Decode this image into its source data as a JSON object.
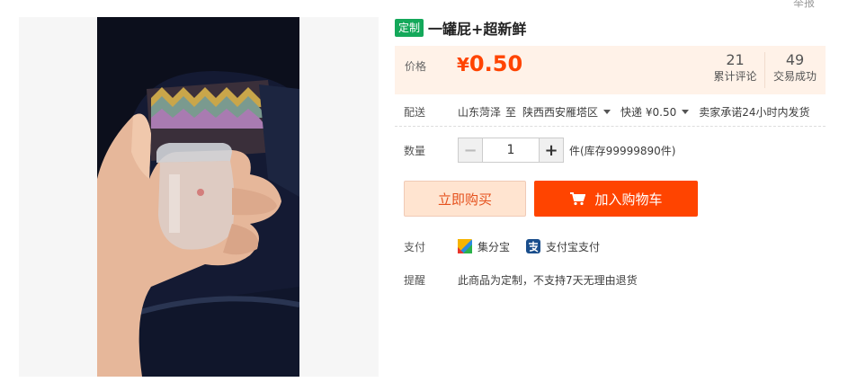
{
  "header": {
    "report_label": "举报"
  },
  "product": {
    "tag": "定制",
    "title": "一罐屁+超新鲜"
  },
  "price": {
    "label": "价格",
    "currency_symbol": "¥",
    "value": "0.50",
    "reviews_count": "21",
    "reviews_label": "累计评论",
    "deals_count": "49",
    "deals_label": "交易成功"
  },
  "shipping": {
    "label": "配送",
    "from": "山东菏泽",
    "to_word": "至",
    "destination": "陕西西安雁塔区",
    "method": "快递 ¥0.50",
    "promise": "卖家承诺24小时内发货"
  },
  "quantity": {
    "label": "数量",
    "value": "1",
    "minus": "−",
    "plus": "+",
    "stock": "件(库存99999890件)"
  },
  "actions": {
    "buy_now": "立即购买",
    "add_to_cart": "加入购物车"
  },
  "payment": {
    "label": "支付",
    "methods": [
      {
        "name": "集分宝",
        "icon": "jifenbao-icon"
      },
      {
        "name": "支付宝支付",
        "icon": "alipay-icon"
      }
    ]
  },
  "notice": {
    "label": "提醒",
    "text": "此商品为定制，不支持7天无理由退货"
  },
  "colors": {
    "price": "#ff4400",
    "tag_green": "#14a85a",
    "cart_button": "#ff4400",
    "buy_button_bg": "#ffe4d0"
  }
}
